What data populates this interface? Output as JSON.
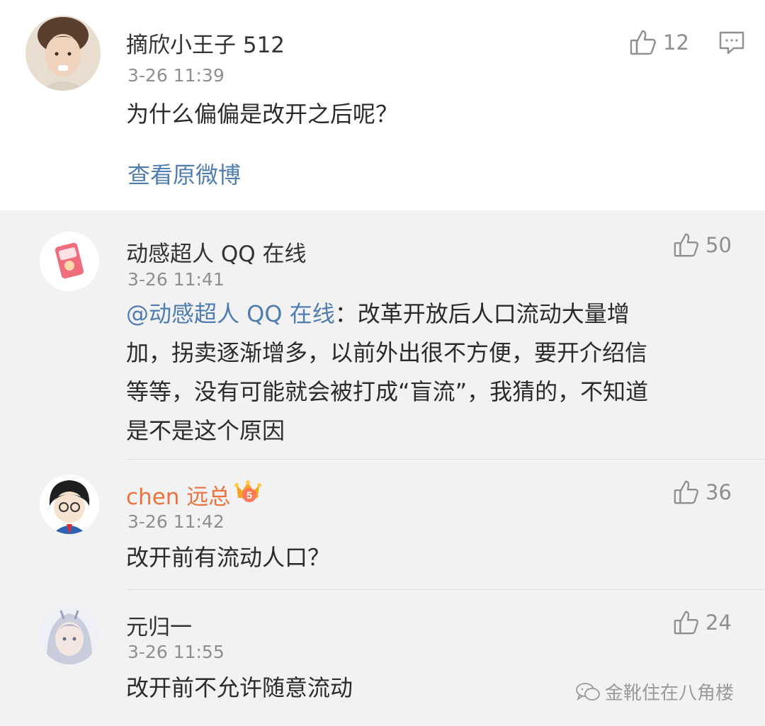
{
  "top_comment": {
    "username": "摘欣小王子 512",
    "time": "3-26 11:39",
    "text": "为什么偏偏是改开之后呢？",
    "likes": "12",
    "view_original": "查看原微博"
  },
  "replies": [
    {
      "username": "动感超人 QQ 在线",
      "time": "3-26 11:41",
      "likes": "50",
      "mention": "@动感超人 QQ 在线",
      "text_line1": "：改革开放后人口流动大量增",
      "text_line2": "加，拐卖逐渐增多，以前外出很不方便，要开介绍信",
      "text_line3": "等等，没有可能就会被打成“盲流”，我猜的，不知道",
      "text_line4": "是不是这个原因"
    },
    {
      "username": "chen 远总",
      "time": "3-26 11:42",
      "likes": "36",
      "text": "改开前有流动人口？",
      "badge": "5"
    },
    {
      "username": "元归一",
      "time": "3-26 11:55",
      "likes": "24",
      "text": "改开前不允许随意流动"
    }
  ],
  "watermark": "金靴住在八角楼",
  "colors": {
    "link": "#507daf",
    "vip_name": "#eb7340",
    "meta": "#8f8f8f",
    "reply_bg": "#f2f2f2"
  }
}
